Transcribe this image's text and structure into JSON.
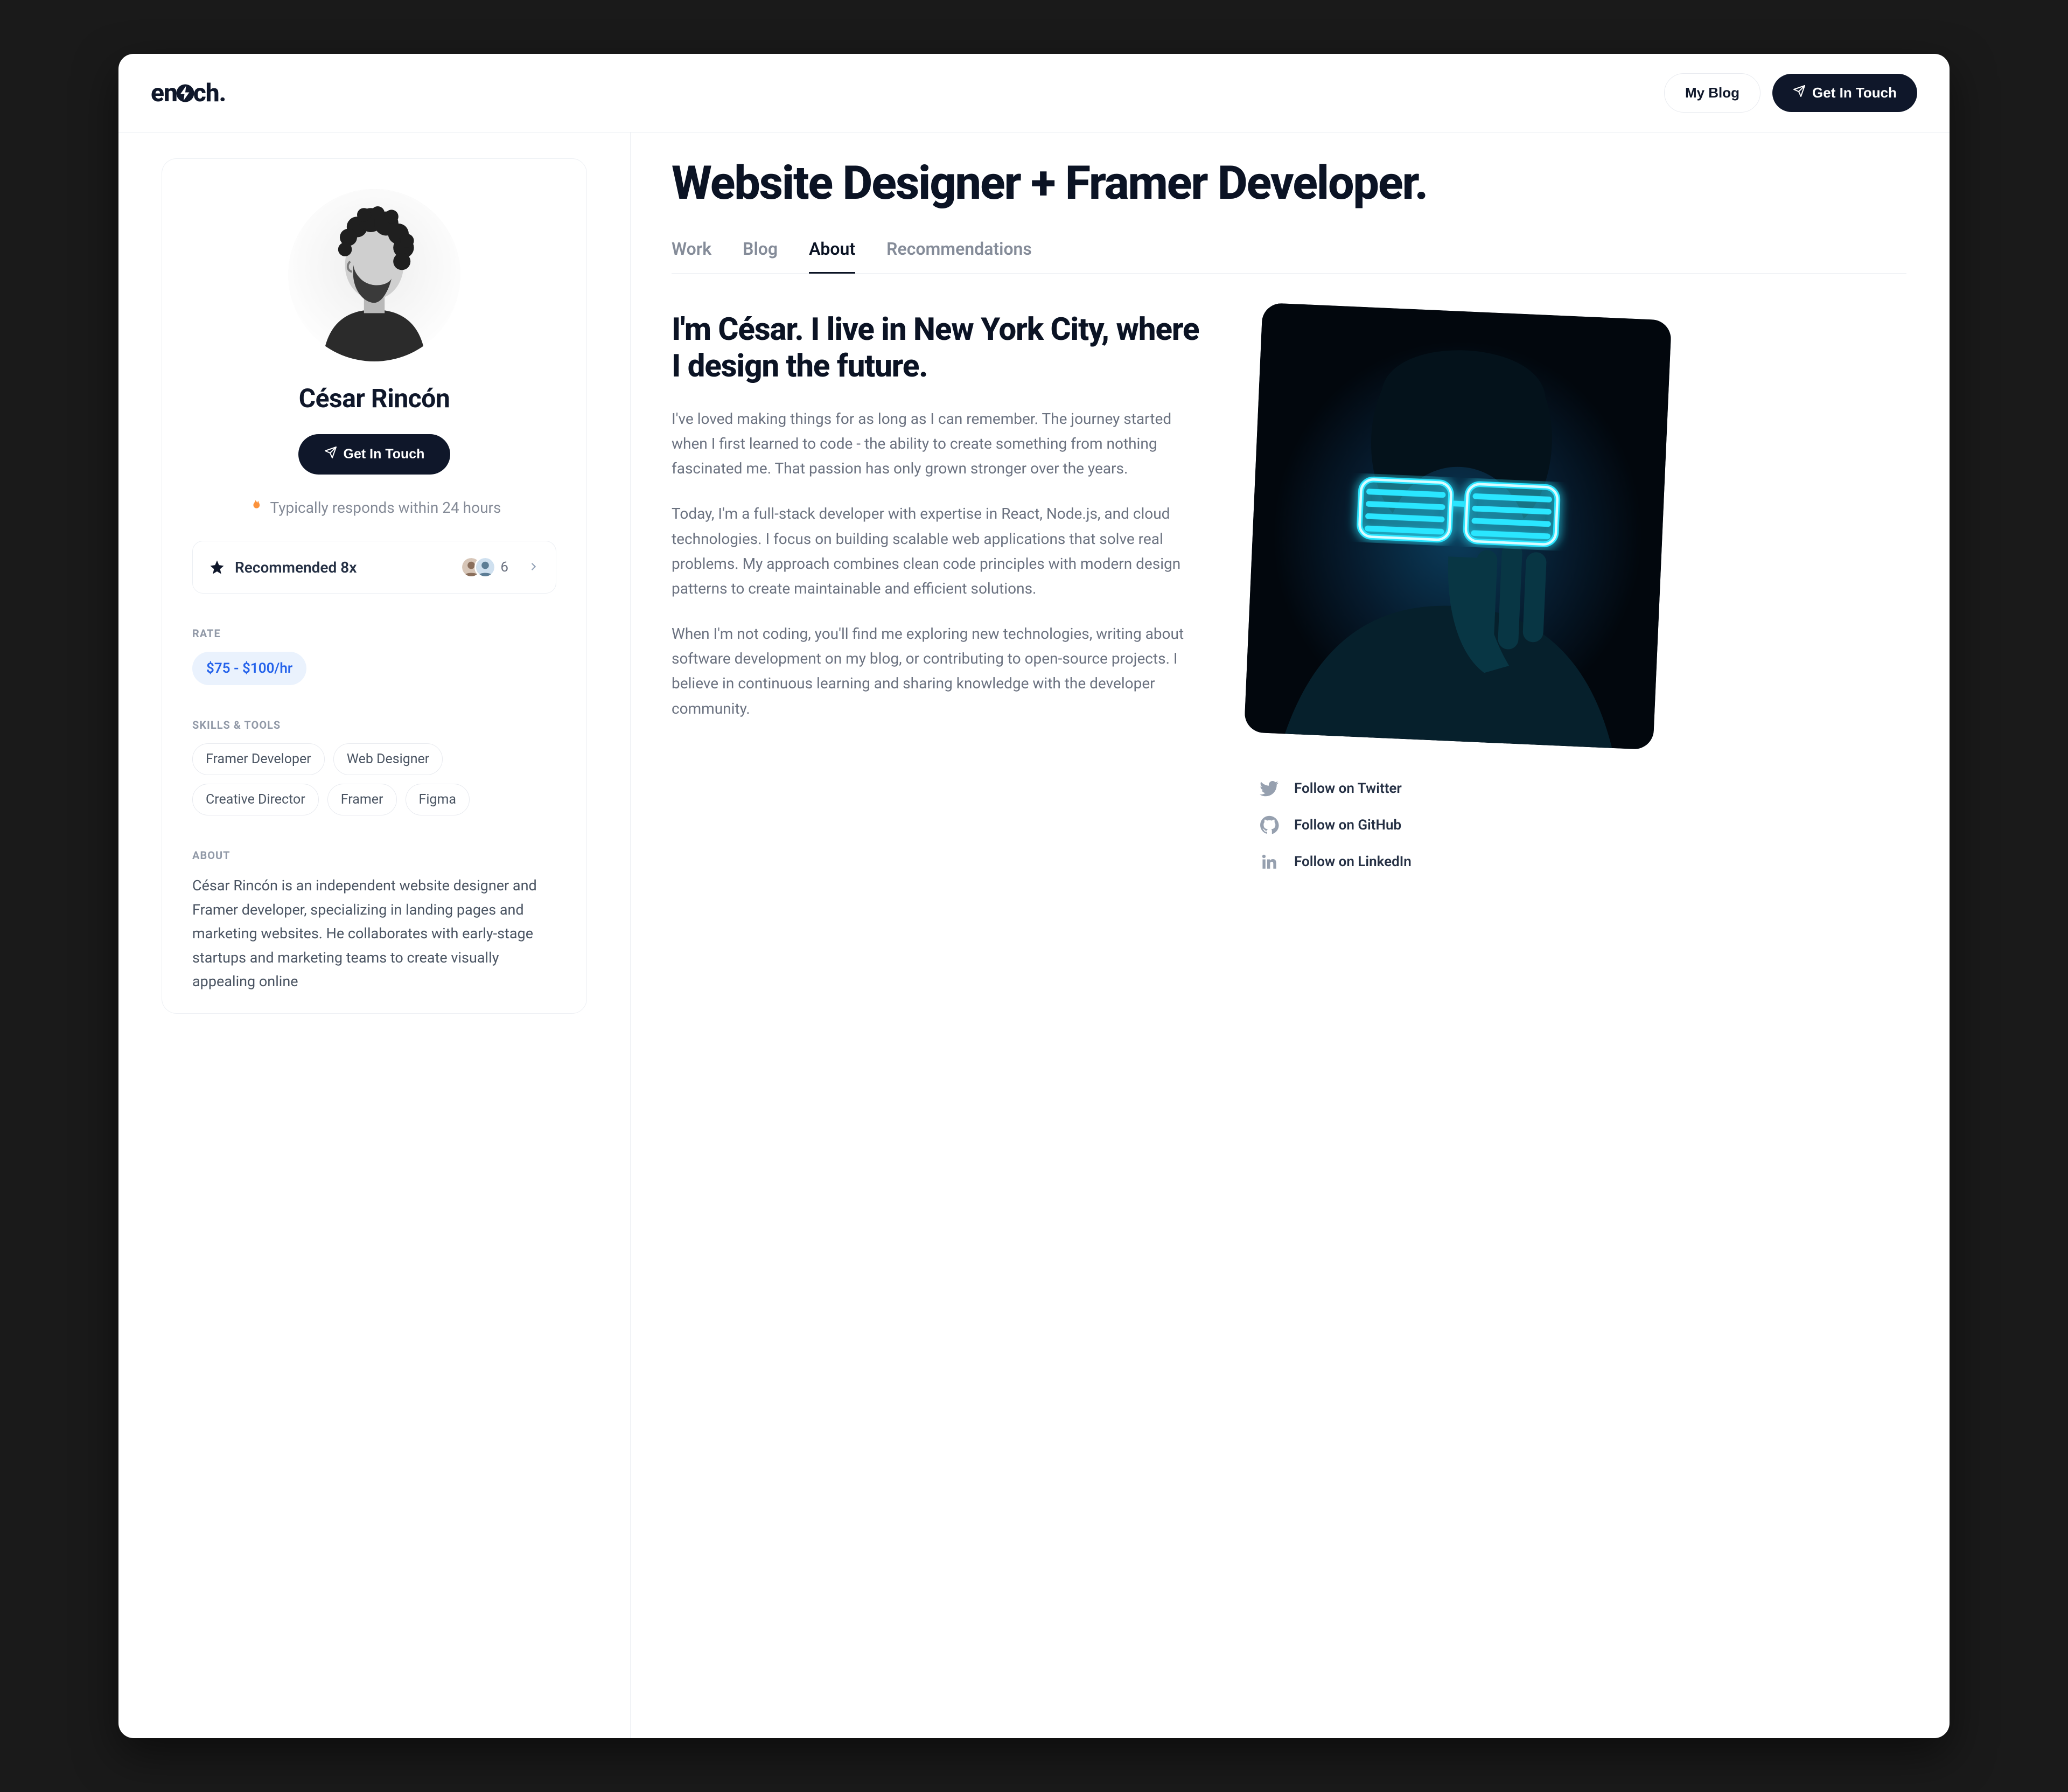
{
  "header": {
    "logo_left": "en",
    "logo_right": "ch.",
    "blog_label": "My Blog",
    "contact_label": "Get In Touch"
  },
  "sidebar": {
    "name": "César Rincón",
    "cta_label": "Get In Touch",
    "responds": "Typically responds within 24 hours",
    "recommended_label": "Recommended 8x",
    "recommended_overflow": "6",
    "rate": {
      "label": "RATE",
      "value": "$75 - $100/hr"
    },
    "skills": {
      "label": "SKILLS & TOOLS",
      "items": [
        "Framer Developer",
        "Web Designer",
        "Creative Director",
        "Framer",
        "Figma"
      ]
    },
    "about": {
      "label": "ABOUT",
      "text": "César Rincón is an independent website designer and Framer developer, specializing in landing pages and marketing websites. He collaborates with early-stage startups and marketing teams to create visually appealing online"
    }
  },
  "main": {
    "title": "Website Designer + Framer Developer.",
    "tabs": [
      "Work",
      "Blog",
      "About",
      "Recommendations"
    ],
    "active_tab": 2,
    "article": {
      "heading": "I'm César. I live in New York City, where I design the future.",
      "p1": "I've loved making things for as long as I can remember. The journey started when I first learned to code - the ability to create something from nothing fascinated me. That passion has only grown stronger over the years.",
      "p2": "Today, I'm a full-stack developer with expertise in React, Node.js, and cloud technologies. I focus on building scalable web applications that solve real problems. My approach combines clean code principles with modern design patterns to create maintainable and efficient solutions.",
      "p3": "When I'm not coding, you'll find me exploring new technologies, writing about software development on my blog, or contributing to open-source projects. I believe in continuous learning and sharing knowledge with the developer community."
    },
    "socials": {
      "twitter": "Follow on Twitter",
      "github": "Follow on GitHub",
      "linkedin": "Follow on LinkedIn"
    }
  }
}
